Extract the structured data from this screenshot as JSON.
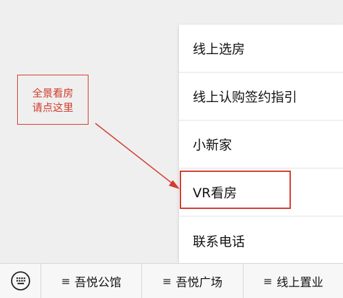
{
  "menu": {
    "items": [
      {
        "label": "线上选房"
      },
      {
        "label": "线上认购签约指引"
      },
      {
        "label": "小新家"
      },
      {
        "label": "VR看房"
      },
      {
        "label": "联系电话"
      }
    ]
  },
  "annotation": {
    "line1": "全景看房",
    "line2": "请点这里",
    "color": "#d53a2d"
  },
  "tabbar": {
    "keyboard_icon": "keyboard-icon",
    "menu_glyph": "≡",
    "tabs": [
      {
        "label": "吾悦公馆"
      },
      {
        "label": "吾悦广场"
      },
      {
        "label": "线上置业"
      }
    ]
  }
}
